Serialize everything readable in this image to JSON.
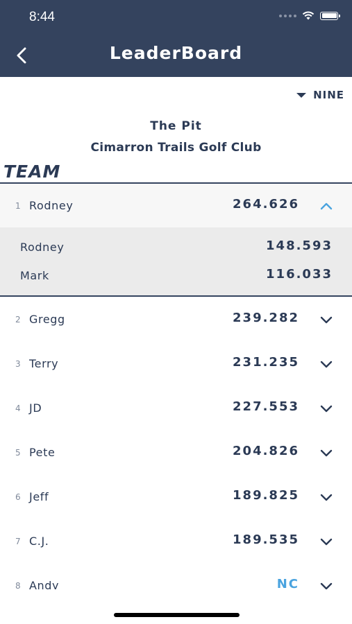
{
  "status_bar": {
    "time": "8:44"
  },
  "header": {
    "title": "LeaderBoard",
    "back_icon": "chevron-left-icon"
  },
  "filter": {
    "label": "NINE",
    "icon": "caret-down-icon"
  },
  "event": {
    "course": "The Pit",
    "club": "Cimarron Trails Golf Club"
  },
  "section": {
    "title": "TEAM"
  },
  "colors": {
    "header_bg": "#34435e",
    "text": "#2b3a55",
    "accent": "#4aa3df"
  },
  "teams": [
    {
      "rank": "1",
      "name": "Rodney",
      "score": "264.626",
      "expanded": true,
      "members": [
        {
          "name": "Rodney",
          "score": "148.593"
        },
        {
          "name": "Mark",
          "score": "116.033"
        }
      ]
    },
    {
      "rank": "2",
      "name": "Gregg",
      "score": "239.282"
    },
    {
      "rank": "3",
      "name": "Terry",
      "score": "231.235"
    },
    {
      "rank": "4",
      "name": "JD",
      "score": "227.553"
    },
    {
      "rank": "5",
      "name": "Pete",
      "score": "204.826"
    },
    {
      "rank": "6",
      "name": "Jeff",
      "score": "189.825"
    },
    {
      "rank": "7",
      "name": "C.J.",
      "score": "189.535"
    },
    {
      "rank": "8",
      "name": "Andy",
      "score": "NC"
    }
  ]
}
